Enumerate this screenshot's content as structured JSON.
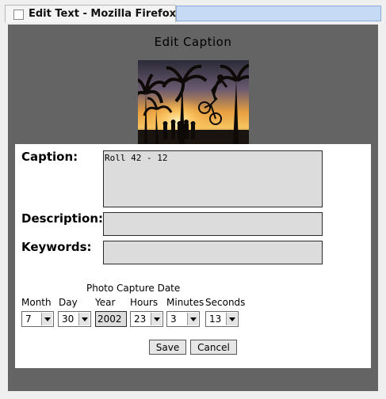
{
  "window": {
    "title": "Edit Text - Mozilla Firefox"
  },
  "page": {
    "heading": "Edit Caption"
  },
  "form": {
    "caption_label": "Caption:",
    "caption_value": "Roll 42 - 12",
    "description_label": "Description:",
    "description_value": "",
    "keywords_label": "Keywords:",
    "keywords_value": "",
    "capture_date_heading": "Photo Capture Date",
    "month_label": "Month",
    "month_value": "7",
    "day_label": "Day",
    "day_value": "30",
    "year_label": "Year",
    "year_value": "2002",
    "hours_label": "Hours",
    "hours_value": "23",
    "minutes_label": "Minutes",
    "minutes_value": "3",
    "seconds_label": "Seconds",
    "seconds_value": "13",
    "save_label": "Save",
    "cancel_label": "Cancel"
  },
  "colors": {
    "background_gray": "#646464",
    "field_gray": "#dcdcdc",
    "titlebar_blue": "#c6daf6"
  }
}
